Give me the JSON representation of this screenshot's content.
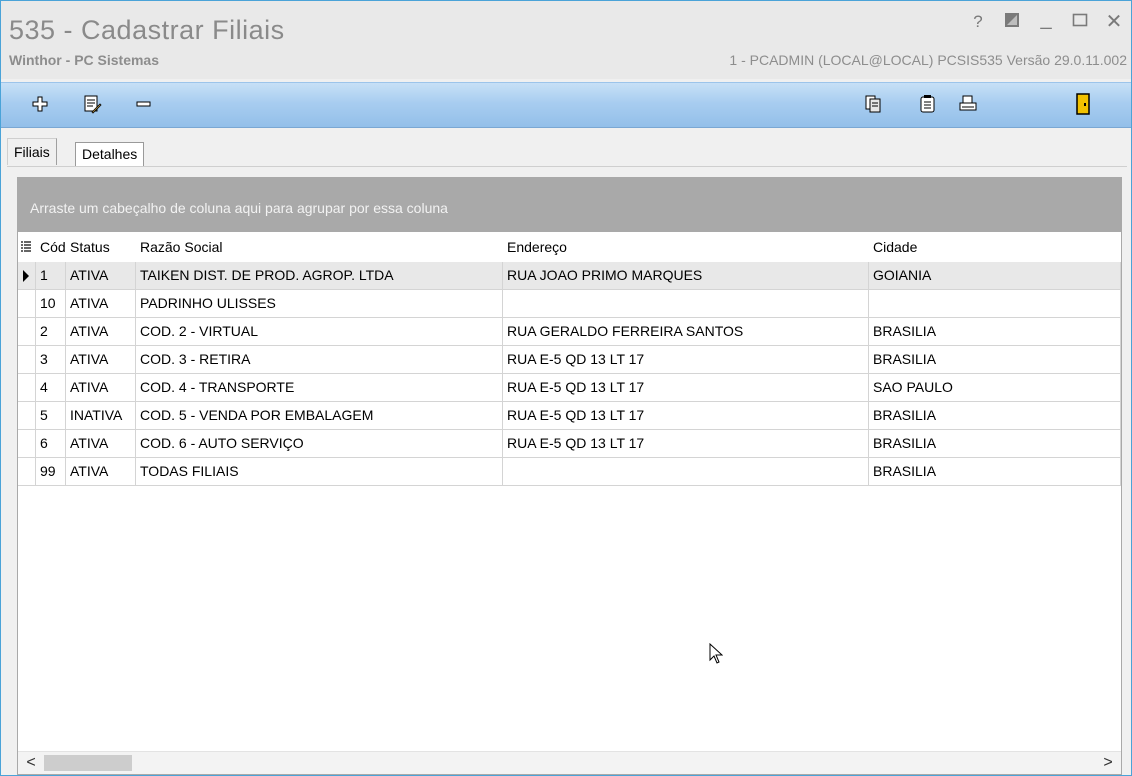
{
  "window": {
    "title": "535 - Cadastrar Filiais",
    "subtitle": "Winthor - PC Sistemas",
    "session_info": "1 - PCADMIN (LOCAL@LOCAL)  PCSIS535  Versão  29.0.11.002",
    "controls": {
      "help": "?",
      "minimize": "_",
      "close": "✕"
    }
  },
  "toolbar": {
    "icons": [
      "add-icon",
      "edit-document-icon",
      "remove-icon",
      "copy-icon",
      "notes-icon",
      "print-icon",
      "exit-door-icon"
    ]
  },
  "tabs": [
    {
      "label": "Filiais",
      "active": true
    },
    {
      "label": "Detalhes",
      "active": false
    }
  ],
  "grid": {
    "group_panel_text": "Arraste um cabeçalho de coluna aqui para agrupar por essa coluna",
    "columns": [
      "Código",
      "Status",
      "Razão Social",
      "Endereço",
      "Cidade"
    ],
    "rows": [
      {
        "codigo": "1",
        "status": "ATIVA",
        "razao": "TAIKEN DIST. DE PROD. AGROP. LTDA",
        "endereco": "RUA JOAO PRIMO MARQUES",
        "cidade": "GOIANIA"
      },
      {
        "codigo": "10",
        "status": "ATIVA",
        "razao": "PADRINHO ULISSES",
        "endereco": "",
        "cidade": ""
      },
      {
        "codigo": "2",
        "status": "ATIVA",
        "razao": "COD. 2 - VIRTUAL",
        "endereco": "RUA GERALDO FERREIRA SANTOS",
        "cidade": "BRASILIA"
      },
      {
        "codigo": "3",
        "status": "ATIVA",
        "razao": "COD. 3 - RETIRA",
        "endereco": "RUA E-5 QD 13 LT 17",
        "cidade": "BRASILIA"
      },
      {
        "codigo": "4",
        "status": "ATIVA",
        "razao": "COD. 4 - TRANSPORTE",
        "endereco": "RUA E-5 QD 13 LT 17",
        "cidade": "SAO PAULO"
      },
      {
        "codigo": "5",
        "status": "INATIVA",
        "razao": "COD. 5 - VENDA POR EMBALAGEM",
        "endereco": "RUA E-5 QD 13 LT 17",
        "cidade": "BRASILIA"
      },
      {
        "codigo": "6",
        "status": "ATIVA",
        "razao": "COD. 6 - AUTO SERVIÇO",
        "endereco": "RUA E-5 QD 13 LT 17",
        "cidade": "BRASILIA"
      },
      {
        "codigo": "99",
        "status": "ATIVA",
        "razao": "TODAS FILIAIS",
        "endereco": "",
        "cidade": "BRASILIA"
      }
    ]
  },
  "scrollbar": {
    "left": "<",
    "right": ">"
  }
}
